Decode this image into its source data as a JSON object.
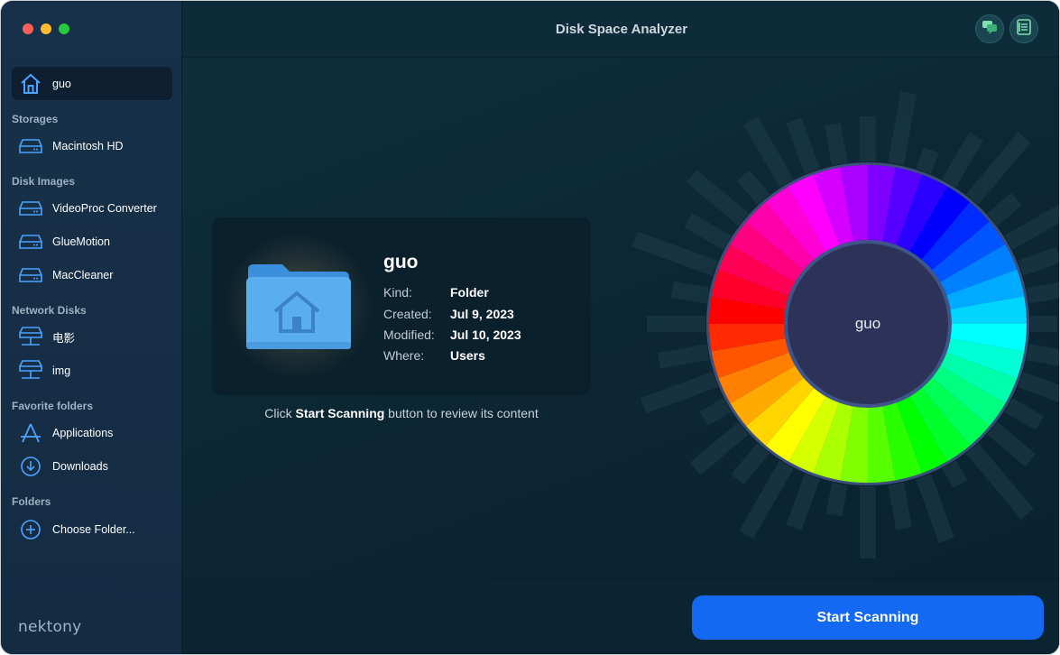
{
  "window": {
    "title": "Disk Space Analyzer"
  },
  "sidebar": {
    "home": {
      "label": "guo",
      "icon": "home-icon"
    },
    "sections": [
      {
        "title": "Storages",
        "items": [
          {
            "label": "Macintosh HD",
            "icon": "drive-icon"
          }
        ]
      },
      {
        "title": "Disk Images",
        "items": [
          {
            "label": "VideoProc Converter",
            "icon": "drive-icon"
          },
          {
            "label": "GlueMotion",
            "icon": "drive-icon"
          },
          {
            "label": "MacCleaner",
            "icon": "drive-icon"
          }
        ]
      },
      {
        "title": "Network Disks",
        "items": [
          {
            "label": "电影",
            "icon": "network-drive-icon"
          },
          {
            "label": "img",
            "icon": "network-drive-icon"
          }
        ]
      },
      {
        "title": "Favorite folders",
        "items": [
          {
            "label": "Applications",
            "icon": "applications-icon"
          },
          {
            "label": "Downloads",
            "icon": "download-icon"
          }
        ]
      },
      {
        "title": "Folders",
        "items": [
          {
            "label": "Choose Folder...",
            "icon": "plus-circle-icon"
          }
        ]
      }
    ],
    "logo": "nektony"
  },
  "toolbar": {
    "buttons": [
      "chat-icon",
      "list-icon"
    ]
  },
  "details": {
    "name": "guo",
    "kind_label": "Kind:",
    "kind": "Folder",
    "created_label": "Created:",
    "created": "Jul 9, 2023",
    "modified_label": "Modified:",
    "modified": "Jul 10, 2023",
    "where_label": "Where:",
    "where": "Users"
  },
  "hint": {
    "prefix": "Click ",
    "action": "Start Scanning",
    "suffix": " button to review its content"
  },
  "wheel": {
    "center_label": "guo"
  },
  "footer": {
    "scan_button": "Start Scanning"
  },
  "colors": {
    "accent": "#1469f2",
    "sidebar_bg": "#17314a",
    "main_bg": "#0f2f3d"
  }
}
